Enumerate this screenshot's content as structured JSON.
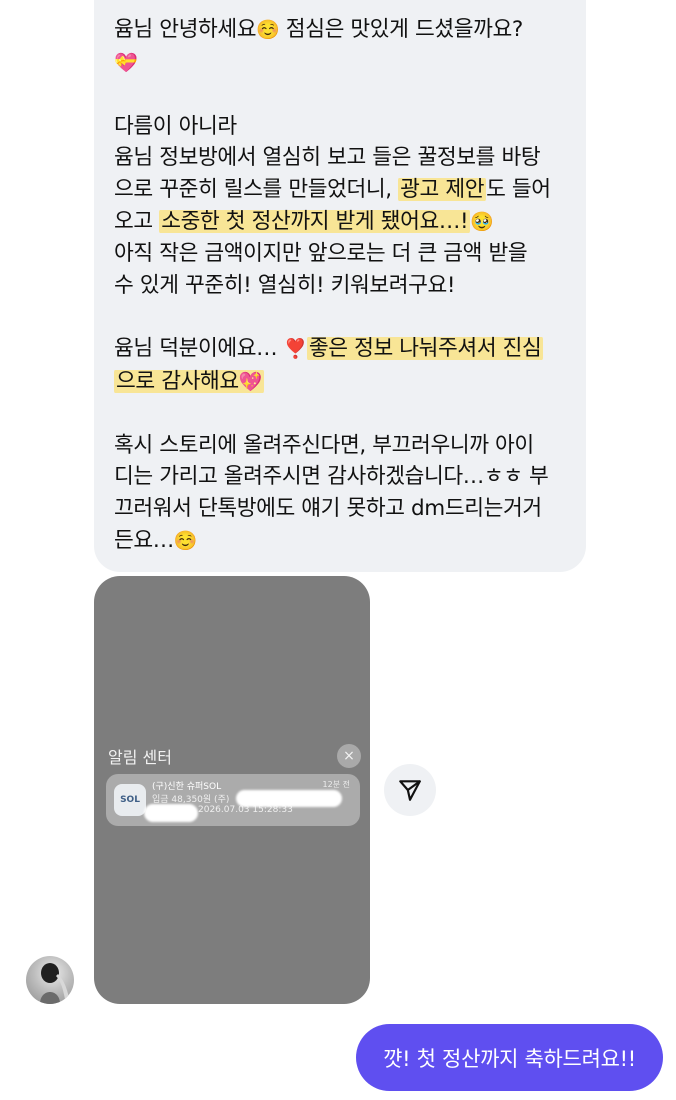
{
  "incoming_message": {
    "para1": {
      "text": "윰님 안녕하세요",
      "emoji1": "☺️",
      "text2": " 점심은 맛있게 드셨을까요?",
      "emoji2": "💝"
    },
    "para2": {
      "line1": "다름이 아니라",
      "line2": "윰님 정보방에서 열심히 보고 들은 꿀정보를 바탕",
      "line3a": "으로 꾸준히 릴스를 만들었더니, ",
      "line3_hl": "광고 제안",
      "line3b": "도 들어",
      "line4a": "오고 ",
      "line4_hl": "소중한 첫 정산까지 받게 됐어요…!",
      "line4_emoji": "🥹",
      "line5": "아직 작은 금액이지만 앞으로는 더 큰 금액 받을",
      "line6": "수 있게 꾸준히! 열심히! 키워보려구요!"
    },
    "para3": {
      "line1a": "윰님 덕분이에요… ",
      "line1_emoji": "❣️",
      "line1_hl": "좋은 정보 나눠주셔서 진심",
      "line2_hl": "으로 감사해요",
      "line2_emoji": "💖"
    },
    "para4": {
      "line1": "혹시 스토리에 올려주신다면, 부끄러우니까 아이",
      "line2": "디는 가리고 올려주시면 감사하겠습니다…ㅎㅎ 부",
      "line3": "끄러워서 단톡방에도 얘기 못하고 dm드리는거거",
      "line4": "든요…",
      "emoji": "☺️"
    }
  },
  "notification_image": {
    "header": "알림 센터",
    "close_symbol": "×",
    "app_icon_text": "SOL",
    "title": "(구)신한 슈퍼SOL",
    "time": "12분 전",
    "body": "입금 48,350원 (주)",
    "date": "2026.07.03 15:28:33"
  },
  "share_icon": "send-icon",
  "outgoing_message": {
    "text": "꺗! 첫 정산까지 축하드려요!!"
  },
  "colors": {
    "incoming_bg": "#eff1f4",
    "outgoing_bg": "#5f4ff0",
    "highlight": "#f8e596"
  }
}
